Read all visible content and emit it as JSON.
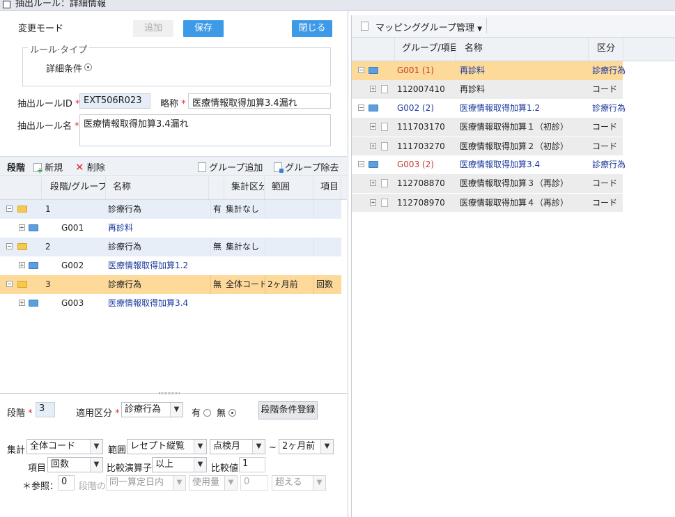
{
  "window_title": "抽出ルール：詳細情報",
  "form": {
    "mode_label": "変更モード",
    "add_button": "追加",
    "save_button": "保存",
    "close_button": "閉じる",
    "rule_type_legend": "ルール·タイプ",
    "rule_type_option": "詳細条件",
    "rule_id_label": "抽出ルールID",
    "rule_id_value": "EXT506R023",
    "short_name_label": "略称",
    "short_name_value": "医療情報取得加算3.4漏れ",
    "rule_name_label": "抽出ルール名",
    "rule_name_value": "医療情報取得加算3.4漏れ",
    "required_mark": "*"
  },
  "stage_toolbar": {
    "title": "段階",
    "new": "新規",
    "delete": "削除",
    "group_add": "グループ追加",
    "group_remove": "グループ除去"
  },
  "stage_grid": {
    "headers": [
      "段階/グループ",
      "名称",
      "集計区分",
      "範囲",
      "項目"
    ],
    "rows": [
      {
        "id": "1",
        "name": "診療行為",
        "flag": "有",
        "agg": "集計なし",
        "range": "",
        "item": ""
      },
      {
        "id": "G001",
        "name": "再診料"
      },
      {
        "id": "2",
        "name": "診療行為",
        "flag": "無",
        "agg": "集計なし",
        "range": "",
        "item": ""
      },
      {
        "id": "G002",
        "name": "医療情報取得加算1.2"
      },
      {
        "id": "3",
        "name": "診療行為",
        "flag": "無",
        "agg": "全体コード",
        "range": "2ヶ月前",
        "item": "回数"
      },
      {
        "id": "G003",
        "name": "医療情報取得加算3.4"
      }
    ]
  },
  "stage_form": {
    "stage_label": "段階",
    "stage_value": "3",
    "apply_label": "適用区分",
    "apply_value": "診療行為",
    "yes": "有",
    "no": "無",
    "register_button": "段階条件登録",
    "agg_label": "集計",
    "agg_value": "全体コード",
    "range_label": "範囲",
    "range_value": "レセプト縦覧",
    "range_unit": "点検月",
    "tilde": "~",
    "range_to": "2ヶ月前",
    "item_label": "項目",
    "item_value": "回数",
    "op_label": "比較演算子",
    "op_value": "以上",
    "cmp_label": "比較値",
    "cmp_value": "1",
    "ref_label": "＊参照：",
    "ref_value": "0",
    "ref_stage_label": "段階の",
    "ref_basis": "同一算定日内",
    "ref_usage": "使用量",
    "ref_num": "0",
    "ref_over": "超える"
  },
  "mapping": {
    "menu_title": "マッピンググループ管理",
    "headers": [
      "グループ/項目",
      "名称",
      "区分"
    ],
    "rows": [
      {
        "code": "G001 (1)",
        "name": "再診料",
        "type": "診療行為"
      },
      {
        "code": "112007410",
        "name": "再診料",
        "type": "コード"
      },
      {
        "code": "G002 (2)",
        "name": "医療情報取得加算1.2",
        "type": "診療行為"
      },
      {
        "code": "111703170",
        "name": "医療情報取得加算１（初診）",
        "type": "コード"
      },
      {
        "code": "111703270",
        "name": "医療情報取得加算２（初診）",
        "type": "コード"
      },
      {
        "code": "G003 (2)",
        "name": "医療情報取得加算3.4",
        "type": "診療行為"
      },
      {
        "code": "112708870",
        "name": "医療情報取得加算３（再診）",
        "type": "コード"
      },
      {
        "code": "112708970",
        "name": "医療情報取得加算４（再診）",
        "type": "コード"
      }
    ]
  }
}
